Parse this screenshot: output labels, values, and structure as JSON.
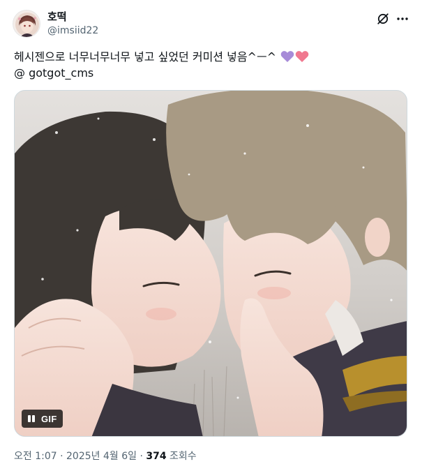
{
  "author": {
    "display_name": "호떡",
    "handle": "@imsiid22"
  },
  "post": {
    "text_line1": "헤시젠으로 너무너무너무 넣고 싶었던 커미션 넣음^ㅡ^",
    "text_line2": "@ gotgot_cms",
    "emojis": [
      "purple-heart",
      "pink-heart"
    ]
  },
  "media": {
    "type": "GIF",
    "badge_label": "GIF"
  },
  "meta": {
    "time": "오전 1:07",
    "separator1": " · ",
    "date": "2025년 4월 6일",
    "separator2": " · ",
    "views_count": "374",
    "views_label": " 조회수"
  },
  "icons": {
    "grok": "grok-icon",
    "more": "more-icon"
  },
  "colors": {
    "text": "#0f1419",
    "secondary": "#536471",
    "purple_heart": "#a78bd8",
    "pink_heart": "#f0788f"
  }
}
